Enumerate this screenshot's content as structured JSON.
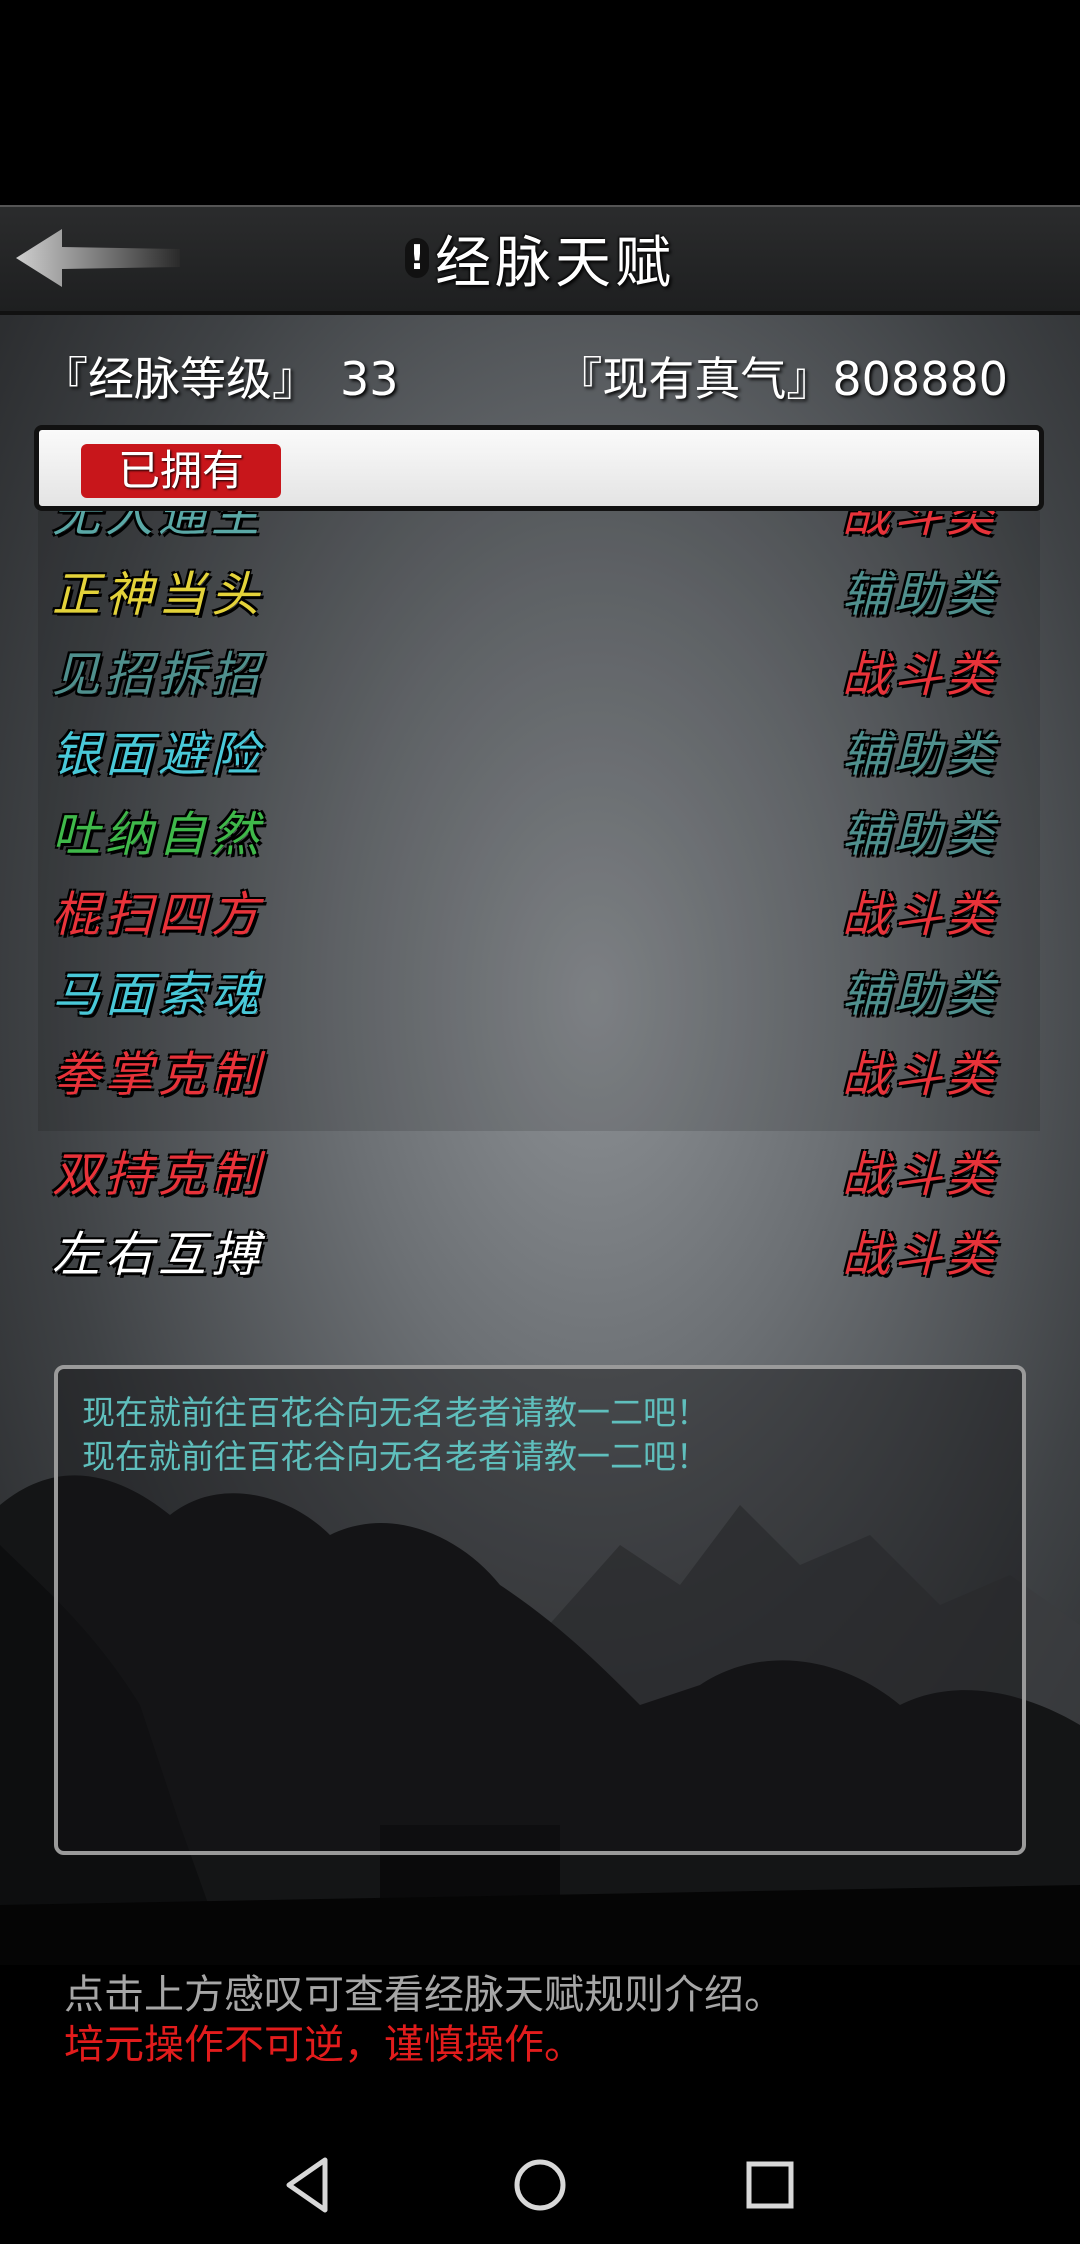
{
  "header": {
    "info_icon": "!",
    "title": "经脉天赋"
  },
  "stats": {
    "level_label": "『经脉等级』",
    "level_value": "33",
    "qi_label": "『现有真气』",
    "qi_value": "808880"
  },
  "tab": {
    "label": "已拥有"
  },
  "talents": [
    {
      "name": "无人通生",
      "type": "战斗类",
      "name_color": "#5aa8a6",
      "type_color": "#e8333a"
    },
    {
      "name": "正神当头",
      "type": "辅助类",
      "name_color": "#e3d23a",
      "type_color": "#4f8f8d"
    },
    {
      "name": "见招拆招",
      "type": "战斗类",
      "name_color": "#4f8f8d",
      "type_color": "#e8333a"
    },
    {
      "name": "银面避险",
      "type": "辅助类",
      "name_color": "#49c8d8",
      "type_color": "#4f8f8d"
    },
    {
      "name": "吐纳自然",
      "type": "辅助类",
      "name_color": "#3fb84a",
      "type_color": "#4f8f8d"
    },
    {
      "name": "棍扫四方",
      "type": "战斗类",
      "name_color": "#e8333a",
      "type_color": "#e8333a"
    },
    {
      "name": "马面索魂",
      "type": "辅助类",
      "name_color": "#49c8d8",
      "type_color": "#4f8f8d"
    },
    {
      "name": "拳掌克制",
      "type": "战斗类",
      "name_color": "#e8333a",
      "type_color": "#e8333a"
    },
    {
      "name": "双持克制",
      "type": "战斗类",
      "name_color": "#e8333a",
      "type_color": "#e8333a"
    },
    {
      "name": "左右互搏",
      "type": "战斗类",
      "name_color": "#ffffff",
      "type_color": "#e8333a"
    }
  ],
  "messages": [
    "现在就前往百花谷向无名老者请教一二吧！",
    "现在就前往百花谷向无名老者请教一二吧！"
  ],
  "hints": {
    "gray": "点击上方感叹可查看经脉天赋规则介绍。",
    "red": "培元操作不可逆，谨慎操作。"
  },
  "icons": {
    "back": "back-arrow-icon",
    "nav_back": "triangle-back-icon",
    "nav_home": "circle-home-icon",
    "nav_recent": "square-recent-icon"
  }
}
